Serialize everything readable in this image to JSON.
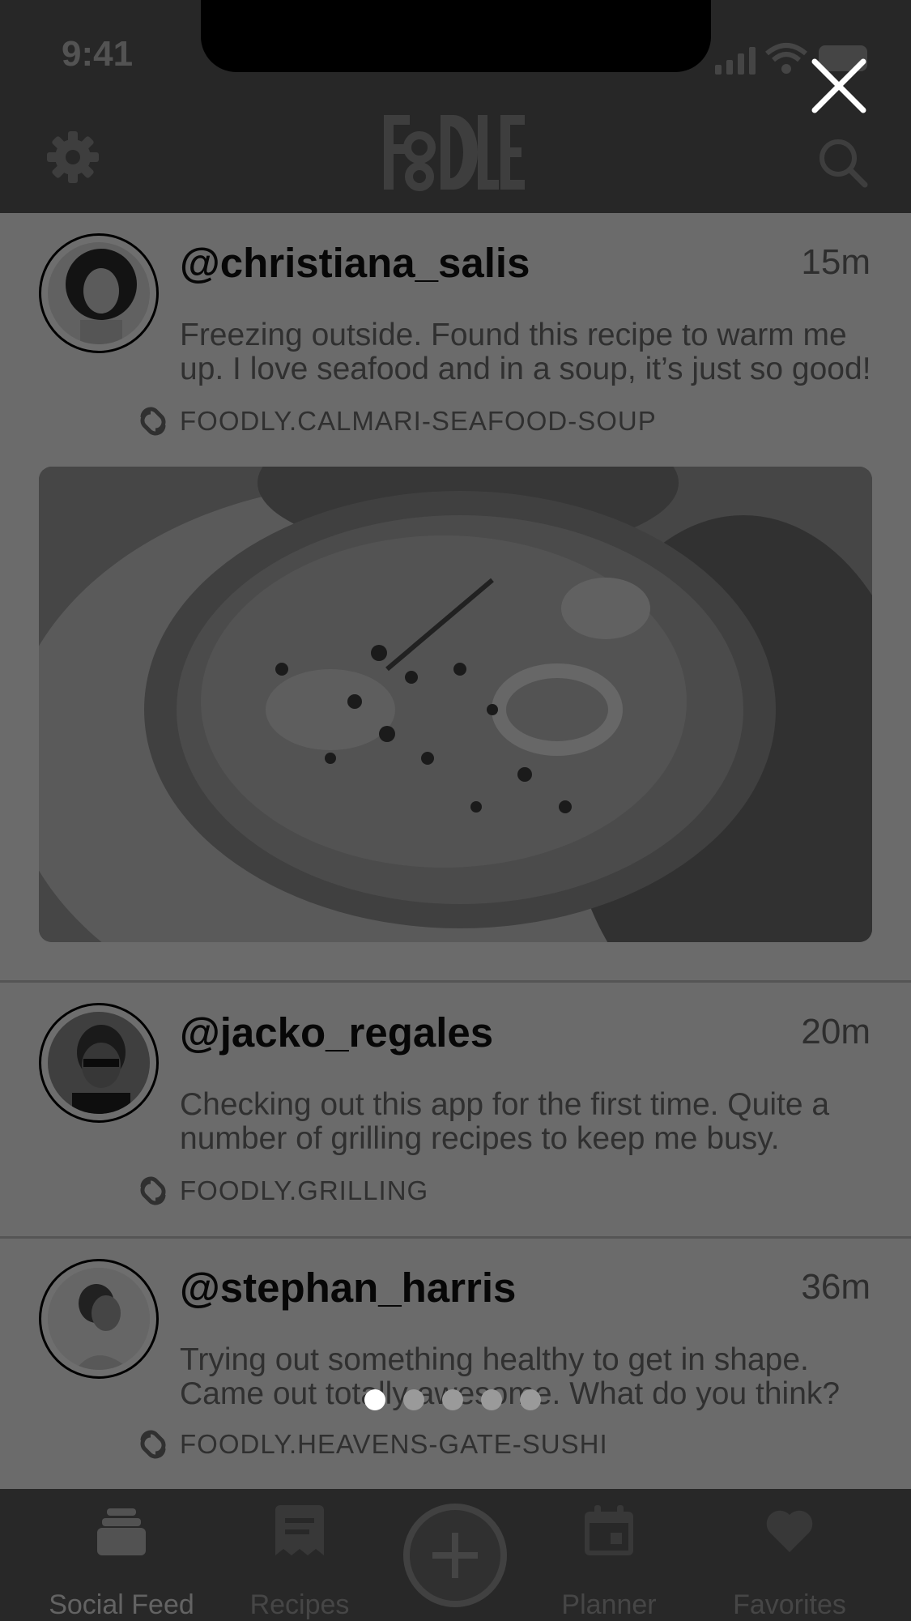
{
  "status_bar": {
    "time": "9:41"
  },
  "header": {
    "logo_text": "FOODLE"
  },
  "posts": [
    {
      "username": "@christiana_salis",
      "time": "15m",
      "text_line1": "Freezing outside. Found this recipe to warm me",
      "text_line2": "up. I love seafood and in a soup, it’s just so good!",
      "link": "FOODLY.CALMARI-SEAFOOD-SOUP"
    },
    {
      "username": "@jacko_regales",
      "time": "20m",
      "text_line1": "Checking out this app for the first time. Quite a",
      "text_line2": "number of grilling recipes to keep me busy.",
      "link": "FOODLY.GRILLING"
    },
    {
      "username": "@stephan_harris",
      "time": "36m",
      "text_line1": "Trying out something healthy to get in shape.",
      "text_line2": "Came out totally awesome. What do you think?",
      "link": "FOODLY.HEAVENS-GATE-SUSHI"
    }
  ],
  "pager": {
    "count": 5,
    "active_index": 0
  },
  "tabs": [
    {
      "label": "Social Feed",
      "icon": "stack-icon",
      "active": true
    },
    {
      "label": "Recipes",
      "icon": "recipe-card-icon",
      "active": false
    },
    {
      "label": "",
      "icon": "plus-icon",
      "active": false
    },
    {
      "label": "Planner",
      "icon": "calendar-icon",
      "active": false
    },
    {
      "label": "Favorites",
      "icon": "heart-icon",
      "active": false
    }
  ],
  "colors": {
    "overlay": "#000000",
    "header": "#575757",
    "background": "#eeeeee"
  }
}
